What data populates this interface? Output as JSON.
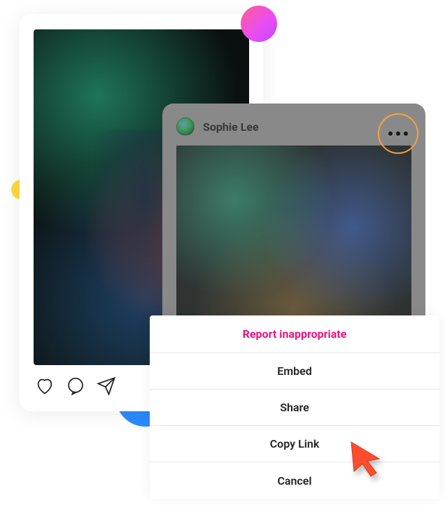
{
  "decorative": {
    "accent_gradient": [
      "#fd5d93",
      "#e94cf7"
    ],
    "yellow": "#ffd93d",
    "blue": "#2d8cff",
    "orange_ring": "#f7a13d",
    "danger": "#e6147f"
  },
  "back_card": {
    "actions": {
      "like_icon": "heart-icon",
      "comment_icon": "comment-icon",
      "share_icon": "send-icon"
    }
  },
  "front_card": {
    "user": {
      "name": "Sophie Lee"
    }
  },
  "action_sheet": {
    "items": [
      {
        "label": "Report inappropriate",
        "danger": true
      },
      {
        "label": "Embed",
        "danger": false
      },
      {
        "label": "Share",
        "danger": false
      },
      {
        "label": "Copy Link",
        "danger": false
      },
      {
        "label": "Cancel",
        "danger": false
      }
    ]
  }
}
